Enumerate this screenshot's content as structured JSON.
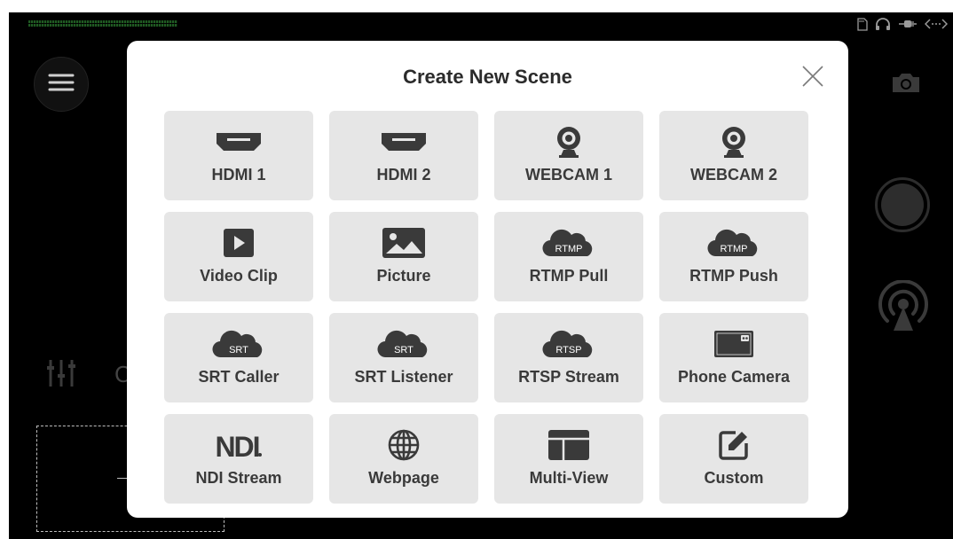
{
  "dialog": {
    "title": "Create New Scene",
    "tiles": [
      {
        "label": "HDMI 1",
        "icon": "hdmi-icon"
      },
      {
        "label": "HDMI 2",
        "icon": "hdmi-icon"
      },
      {
        "label": "WEBCAM 1",
        "icon": "webcam-icon"
      },
      {
        "label": "WEBCAM 2",
        "icon": "webcam-icon"
      },
      {
        "label": "Video Clip",
        "icon": "play-icon"
      },
      {
        "label": "Picture",
        "icon": "picture-icon"
      },
      {
        "label": "RTMP Pull",
        "icon": "cloud-icon",
        "badge": "RTMP"
      },
      {
        "label": "RTMP Push",
        "icon": "cloud-icon",
        "badge": "RTMP"
      },
      {
        "label": "SRT Caller",
        "icon": "cloud-icon",
        "badge": "SRT"
      },
      {
        "label": "SRT Listener",
        "icon": "cloud-icon",
        "badge": "SRT"
      },
      {
        "label": "RTSP Stream",
        "icon": "cloud-icon",
        "badge": "RTSP"
      },
      {
        "label": "Phone Camera",
        "icon": "phone-camera-icon"
      },
      {
        "label": "NDI Stream",
        "icon": "ndi-logo",
        "logo_text": "NDI"
      },
      {
        "label": "Webpage",
        "icon": "globe-icon"
      },
      {
        "label": "Multi-View",
        "icon": "multiview-icon"
      },
      {
        "label": "Custom",
        "icon": "edit-icon"
      }
    ]
  },
  "background": {
    "partial_text": "C"
  },
  "colors": {
    "screen_bg": "#000000",
    "dialog_bg": "#ffffff",
    "tile_bg": "#e6e6e6",
    "icon_color": "#3a3a3a",
    "meter_green": "#1f5a22"
  }
}
